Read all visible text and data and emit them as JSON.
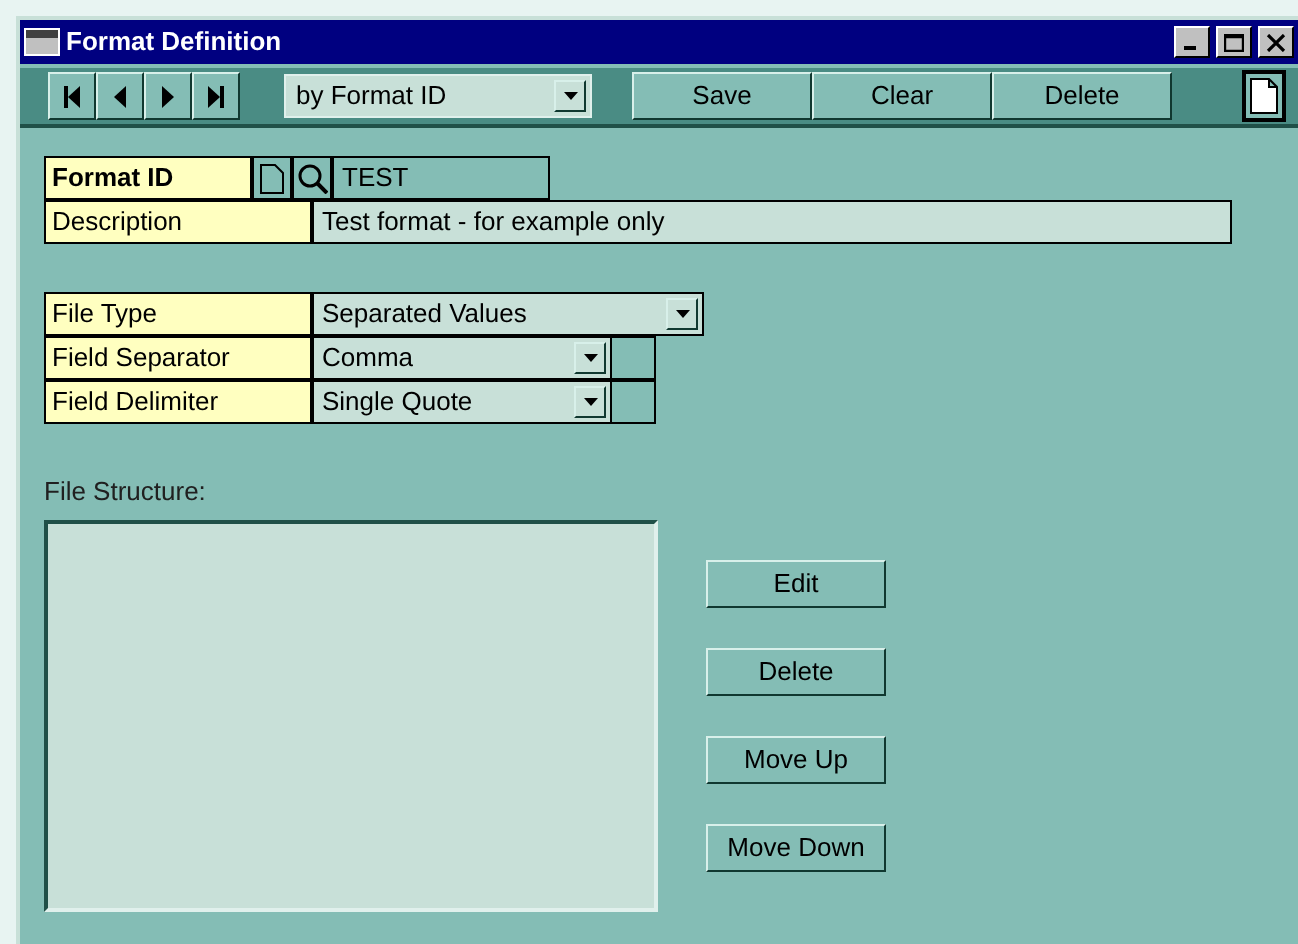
{
  "window": {
    "title": "Format Definition"
  },
  "toolbar": {
    "sort": "by Format ID",
    "buttons": [
      "Save",
      "Clear",
      "Delete"
    ]
  },
  "header_fields": [
    {
      "label": "Format ID",
      "value": "TEST",
      "kind": "id"
    },
    {
      "label": "Description",
      "value": "Test format - for example only",
      "kind": "text"
    }
  ],
  "type_fields": [
    {
      "label": "File Type",
      "value": "Separated Values",
      "kind": "wide"
    },
    {
      "label": "Field Separator",
      "value": "Comma",
      "kind": "narrow"
    },
    {
      "label": "Field Delimiter",
      "value": "Single Quote",
      "kind": "narrow"
    }
  ],
  "structure": {
    "label": "File Structure:",
    "buttons": [
      "Edit",
      "Delete",
      "Move Up",
      "Move Down"
    ]
  }
}
